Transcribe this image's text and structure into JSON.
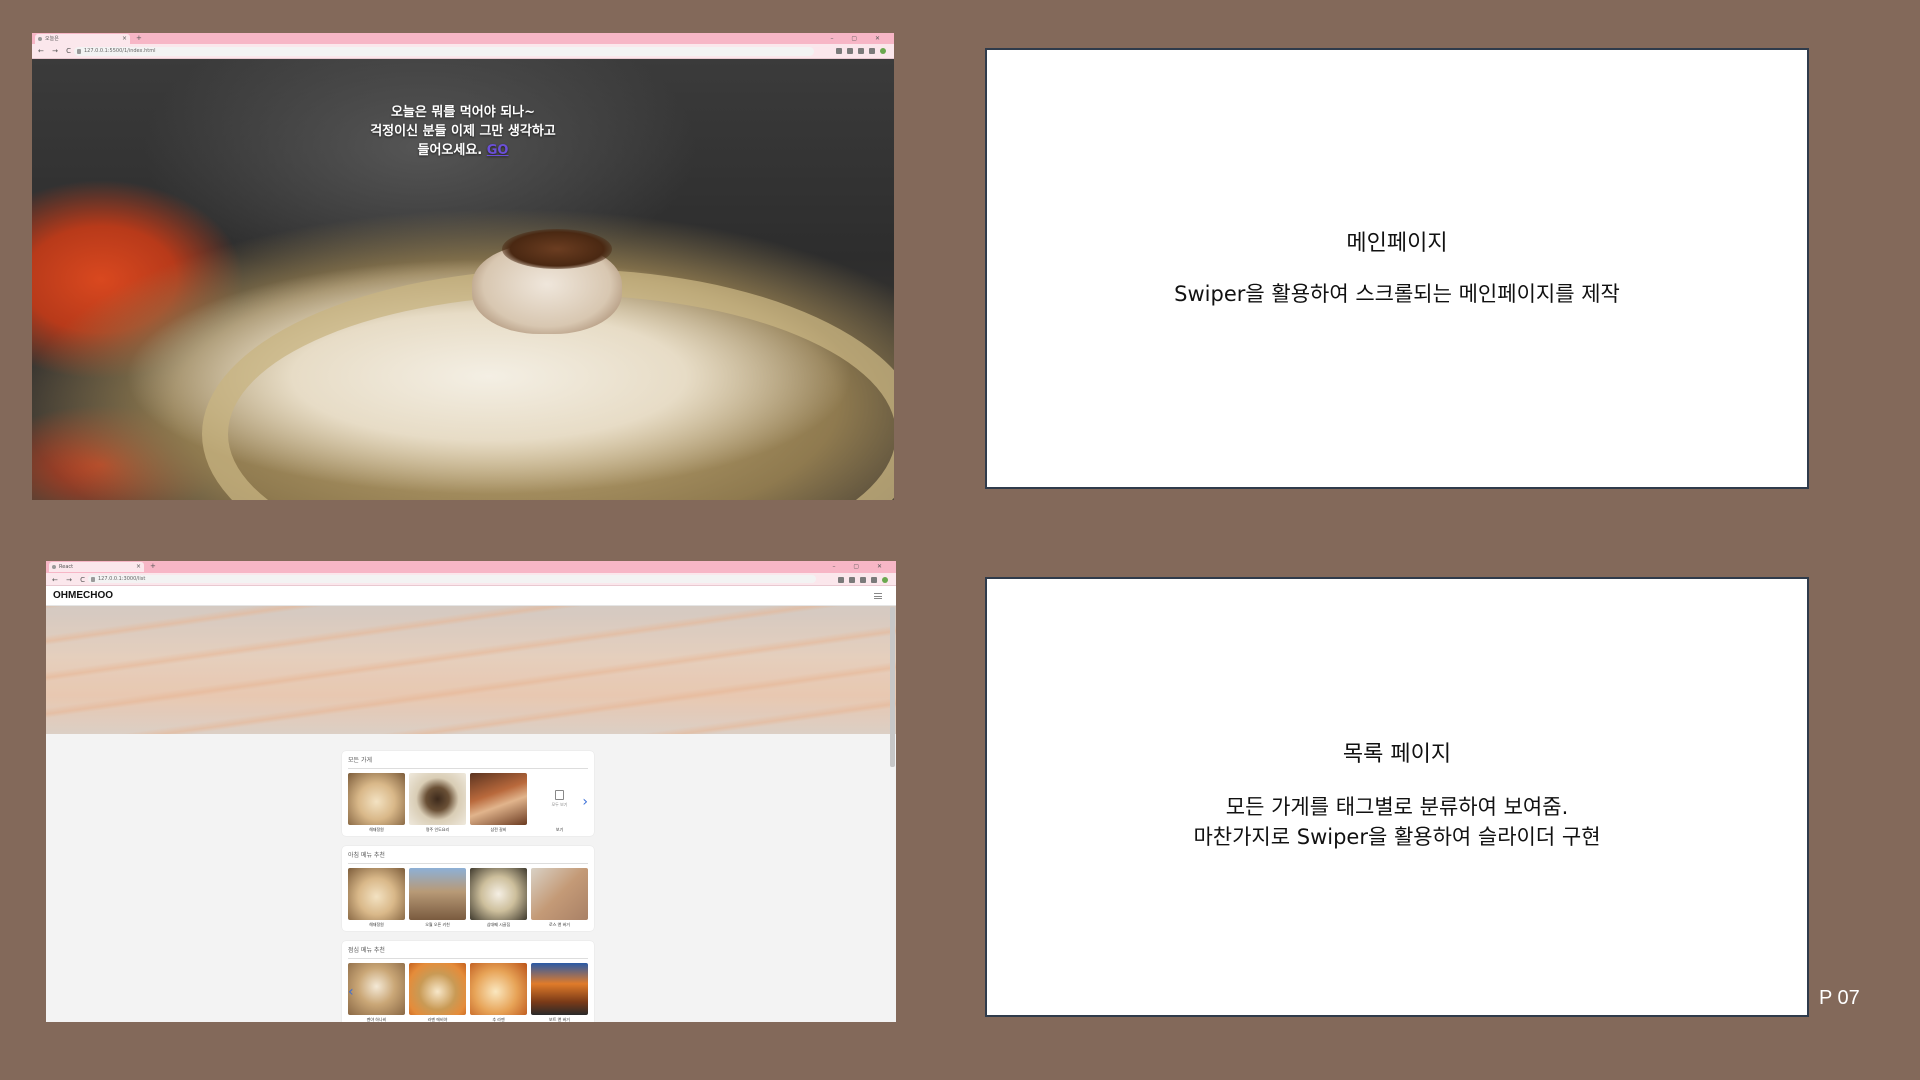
{
  "shot1": {
    "tab_title": "오늘은",
    "new_tab": "+",
    "window_controls": "– ▢ ✕",
    "nav": "← → C",
    "url": "127.0.0.1:5500/1/index.html",
    "hero_line1": "오늘은 뭐를 먹어야 되나~",
    "hero_line2": "걱정이신 분들 이제 그만 생각하고",
    "hero_line3": "들어오세요.",
    "hero_link": "GO"
  },
  "shot2": {
    "tab_title": "React",
    "new_tab": "+",
    "window_controls": "– ▢ ✕",
    "nav": "← → C",
    "url": "127.0.0.1:3000/list",
    "brand": "OHMECHOO",
    "sections": [
      {
        "title": "모든 가게",
        "items": [
          "해재정원",
          "명주 인도요리",
          "삼전 갈비"
        ],
        "more_label": "모두 보기",
        "more_caption": "보기"
      },
      {
        "title": "아침 메뉴 추천",
        "items": [
          "해재정원",
          "오월 오픈 키친",
          "삼대째 시골집",
          "로스 앤 버거"
        ]
      },
      {
        "title": "점심 메뉴 추천",
        "items": [
          "멘야 하나비",
          "라멘 에비야",
          "추 라멘",
          "보트 앤 버거"
        ]
      }
    ]
  },
  "panel1": {
    "title": "메인페이지",
    "desc": "Swiper을 활용하여 스크롤되는 메인페이지를 제작"
  },
  "panel2": {
    "title": "목록 페이지",
    "desc_line1": "모든 가게를 태그별로 분류하여 보여줌.",
    "desc_line2": "마찬가지로 Swiper을 활용하여 슬라이더 구현"
  },
  "page_number": "P 07",
  "colors": {
    "background": "#83695a",
    "panel_border": "#2f3b4b",
    "chrome_pink": "#f7b6c6",
    "arrow_blue": "#3b6fd8"
  }
}
